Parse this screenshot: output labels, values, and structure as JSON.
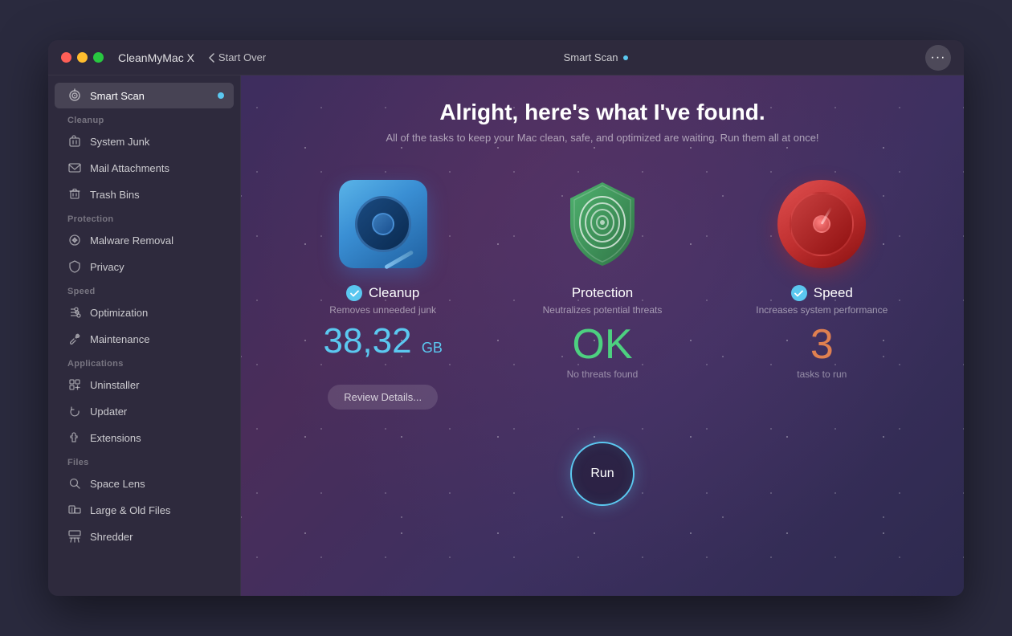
{
  "window": {
    "title": "CleanMyMac X",
    "nav_back": "Start Over",
    "scan_label": "Smart Scan",
    "more_label": "•••"
  },
  "sidebar": {
    "active_item": "smart-scan",
    "items": [
      {
        "id": "smart-scan",
        "label": "Smart Scan",
        "section": null,
        "active": true
      },
      {
        "id": "system-junk",
        "label": "System Junk",
        "section": "Cleanup",
        "active": false
      },
      {
        "id": "mail-attachments",
        "label": "Mail Attachments",
        "section": null,
        "active": false
      },
      {
        "id": "trash-bins",
        "label": "Trash Bins",
        "section": null,
        "active": false
      },
      {
        "id": "malware-removal",
        "label": "Malware Removal",
        "section": "Protection",
        "active": false
      },
      {
        "id": "privacy",
        "label": "Privacy",
        "section": null,
        "active": false
      },
      {
        "id": "optimization",
        "label": "Optimization",
        "section": "Speed",
        "active": false
      },
      {
        "id": "maintenance",
        "label": "Maintenance",
        "section": null,
        "active": false
      },
      {
        "id": "uninstaller",
        "label": "Uninstaller",
        "section": "Applications",
        "active": false
      },
      {
        "id": "updater",
        "label": "Updater",
        "section": null,
        "active": false
      },
      {
        "id": "extensions",
        "label": "Extensions",
        "section": null,
        "active": false
      },
      {
        "id": "space-lens",
        "label": "Space Lens",
        "section": "Files",
        "active": false
      },
      {
        "id": "large-old-files",
        "label": "Large & Old Files",
        "section": null,
        "active": false
      },
      {
        "id": "shredder",
        "label": "Shredder",
        "section": null,
        "active": false
      }
    ]
  },
  "main": {
    "heading": "Alright, here's what I've found.",
    "subtitle": "All of the tasks to keep your Mac clean, safe, and optimized are waiting. Run them all at once!",
    "cards": [
      {
        "id": "cleanup",
        "name": "Cleanup",
        "desc": "Removes unneeded junk",
        "value": "38,32",
        "unit": "GB",
        "sublabel": "",
        "has_check": true,
        "has_button": true,
        "button_label": "Review Details...",
        "value_color": "cyan"
      },
      {
        "id": "protection",
        "name": "Protection",
        "desc": "Neutralizes potential threats",
        "value": "OK",
        "unit": "",
        "sublabel": "No threats found",
        "has_check": false,
        "has_button": false,
        "button_label": "",
        "value_color": "green"
      },
      {
        "id": "speed",
        "name": "Speed",
        "desc": "Increases system performance",
        "value": "3",
        "unit": "",
        "sublabel": "tasks to run",
        "has_check": true,
        "has_button": false,
        "button_label": "",
        "value_color": "orange"
      }
    ],
    "run_button_label": "Run"
  }
}
